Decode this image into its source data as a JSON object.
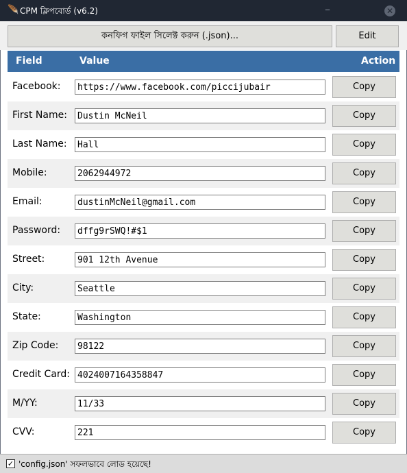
{
  "window": {
    "title": "CPM ক্লিপবোর্ড (v6.2)",
    "app_icon": "feather-icon",
    "minimize_symbol": "–",
    "close_symbol": "✕"
  },
  "toolbar": {
    "select_config_label": "কনফিগ ফাইল সিলেক্ট করুন (.json)...",
    "edit_label": "Edit"
  },
  "table": {
    "headers": {
      "field": "Field",
      "value": "Value",
      "action": "Action"
    },
    "header_color": "#3a6ea5",
    "rows": [
      {
        "label": "Facebook:",
        "value": "https://www.facebook.com/piccijubair",
        "action": "Copy"
      },
      {
        "label": "First Name:",
        "value": "Dustin McNeil",
        "action": "Copy"
      },
      {
        "label": "Last Name:",
        "value": "Hall",
        "action": "Copy"
      },
      {
        "label": "Mobile:",
        "value": "2062944972",
        "action": "Copy"
      },
      {
        "label": "Email:",
        "value": "dustinMcNeil@gmail.com",
        "action": "Copy"
      },
      {
        "label": "Password:",
        "value": "dffg9rSWQ!#$1",
        "action": "Copy"
      },
      {
        "label": "Street:",
        "value": "901 12th Avenue",
        "action": "Copy"
      },
      {
        "label": "City:",
        "value": "Seattle",
        "action": "Copy"
      },
      {
        "label": "State:",
        "value": "Washington",
        "action": "Copy"
      },
      {
        "label": "Zip Code:",
        "value": "98122",
        "action": "Copy"
      },
      {
        "label": "Credit Card:",
        "value": "4024007164358847",
        "action": "Copy"
      },
      {
        "label": "M/YY:",
        "value": "11/33",
        "action": "Copy"
      },
      {
        "label": "CVV:",
        "value": "221",
        "action": "Copy"
      }
    ]
  },
  "status": {
    "checked": true,
    "check_mark": "✓",
    "text": "'config.json' সফলভাবে লোড হয়েছে!"
  }
}
